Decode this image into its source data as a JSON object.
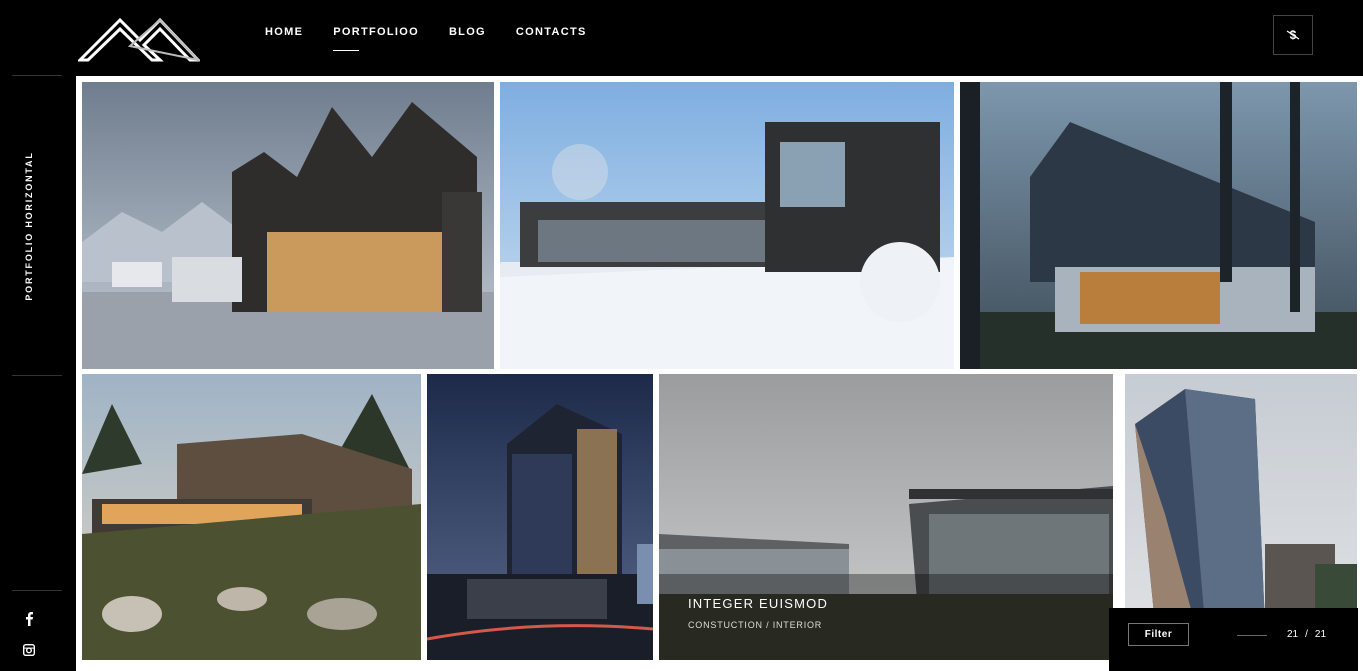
{
  "nav": {
    "items": [
      {
        "label": "HOME",
        "active": false
      },
      {
        "label": "PORTFOLIOO",
        "active": true
      },
      {
        "label": "BLOG",
        "active": false
      },
      {
        "label": "CONTACTS",
        "active": false
      }
    ]
  },
  "header": {
    "logo_icon": "mountain-logo",
    "corner_icon": "dollar-swap-icon"
  },
  "sidebar": {
    "title": "PORTFOLIO HORIZONTAL",
    "social": [
      "facebook-icon",
      "instagram-icon"
    ]
  },
  "gallery": {
    "hovered_item": {
      "title": "INTEGER EUISMOD",
      "subtitle": "CONSTUCTION / INTERIOR"
    }
  },
  "controls": {
    "filter_label": "Filter",
    "current": "21",
    "separator": "/",
    "total": "21"
  }
}
